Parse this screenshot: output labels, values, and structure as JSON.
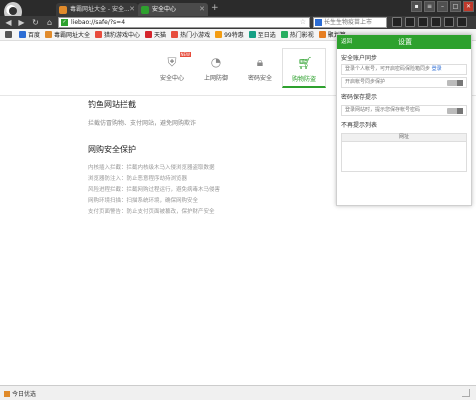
{
  "tabs": [
    {
      "title": "毒霸网址大全 - 安全..."
    },
    {
      "title": "安全中心"
    }
  ],
  "address": {
    "url": "liebao://safe/?s=4"
  },
  "search": {
    "placeholder": "长生生物疫苗上市"
  },
  "bookmarks": [
    {
      "label": "百度",
      "color": "#2b6cd4"
    },
    {
      "label": "毒霸网址大全",
      "color": "#e08a2a"
    },
    {
      "label": "猎豹游戏中心",
      "color": "#e84c3d"
    },
    {
      "label": "天猫",
      "color": "#d4232a"
    },
    {
      "label": "热门小游戏",
      "color": "#e74c3c"
    },
    {
      "label": "99特惠",
      "color": "#f39c12"
    },
    {
      "label": "至日选",
      "color": "#16a085"
    },
    {
      "label": "热门影视",
      "color": "#27ae60"
    },
    {
      "label": "聚划算",
      "color": "#e67e22"
    }
  ],
  "topnav": {
    "items": [
      {
        "label": "安全中心",
        "icon": "shield-icon",
        "badge": "NEW"
      },
      {
        "label": "上网防御",
        "icon": "speedometer-icon"
      },
      {
        "label": "密码安全",
        "icon": "lock-icon"
      },
      {
        "label": "购物防盗",
        "icon": "cart-icon"
      }
    ]
  },
  "phishing": {
    "title": "钓鱼网站拦截",
    "desc": "拦截仿冒购物、支付网站，避免网购欺诈"
  },
  "shopping": {
    "title": "网购安全保护",
    "items": [
      "内核插入拦截：拦截内核级木马入侵浏览器盗取数据",
      "浏览器防注入：防止恶意程序劫持浏览器",
      "风险进程拦截：拦截网购过程运行，避免病毒木马侵害",
      "网购环境扫描：扫描系统环境，确保网购安全",
      "支付页面警告：防止支付页面被篡改，保护财产安全"
    ]
  },
  "panel": {
    "back_label": "返回",
    "title": "设置",
    "account_group": "安全账户同步",
    "account_desc": "登录个人帐号，可开启密码保险箱同步",
    "account_link": "登录",
    "account_protect": "开启帐号同步保护",
    "password_group": "密码保存提示",
    "password_desc": "登录网站时，提示您保存帐号密码",
    "nosave_group": "不再提示列表",
    "table_header": "网址"
  },
  "status": {
    "text": "今日优选"
  },
  "colors": {
    "accent": "#2ea12e",
    "dark": "#2b2b2b"
  }
}
